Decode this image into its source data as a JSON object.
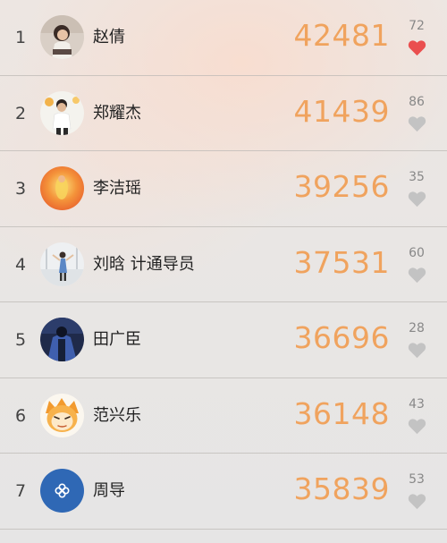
{
  "leaderboard": {
    "rows": [
      {
        "rank": "1",
        "name": "赵倩",
        "score": "42481",
        "likes": "72",
        "liked": true,
        "avatar": "avatar-child-photo"
      },
      {
        "rank": "2",
        "name": "郑耀杰",
        "score": "41439",
        "likes": "86",
        "liked": false,
        "avatar": "avatar-person-photo"
      },
      {
        "rank": "3",
        "name": "李洁瑶",
        "score": "39256",
        "likes": "35",
        "liked": false,
        "avatar": "avatar-orange-photo"
      },
      {
        "rank": "4",
        "name": "刘晗 计通导员",
        "score": "37531",
        "likes": "60",
        "liked": false,
        "avatar": "avatar-outdoor-photo"
      },
      {
        "rank": "5",
        "name": "田广臣",
        "score": "36696",
        "likes": "28",
        "liked": false,
        "avatar": "avatar-dark-photo"
      },
      {
        "rank": "6",
        "name": "范兴乐",
        "score": "36148",
        "likes": "43",
        "liked": false,
        "avatar": "avatar-cartoon"
      },
      {
        "rank": "7",
        "name": "周导",
        "score": "35839",
        "likes": "53",
        "liked": false,
        "avatar": "avatar-blue-logo"
      }
    ]
  },
  "colors": {
    "score": "#f0a35e",
    "heart_active": "#ea4f4f",
    "heart_inactive": "#c3c3c3"
  }
}
